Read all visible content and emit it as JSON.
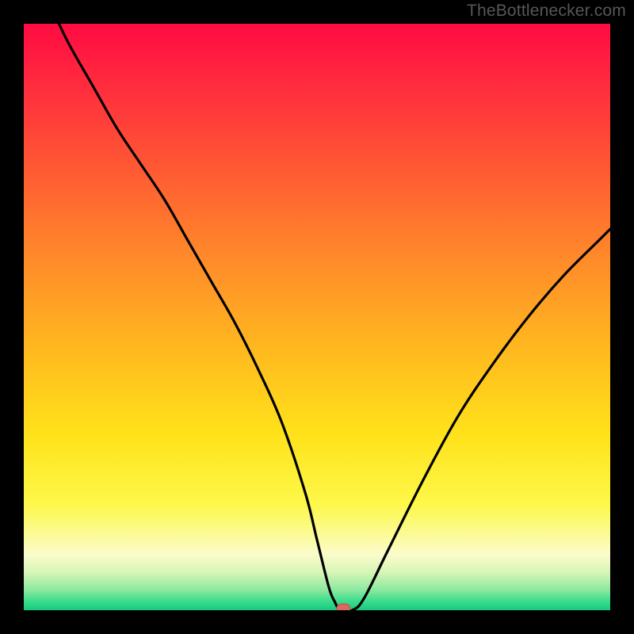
{
  "attribution": "TheBottlenecker.com",
  "colors": {
    "frame": "#000000",
    "gradient_stops": [
      {
        "offset": 0.0,
        "color": "#ff0b42"
      },
      {
        "offset": 0.1,
        "color": "#ff2a3e"
      },
      {
        "offset": 0.25,
        "color": "#ff5a33"
      },
      {
        "offset": 0.4,
        "color": "#ff8a2a"
      },
      {
        "offset": 0.55,
        "color": "#ffb71f"
      },
      {
        "offset": 0.7,
        "color": "#ffe21a"
      },
      {
        "offset": 0.82,
        "color": "#fdf84a"
      },
      {
        "offset": 0.905,
        "color": "#fbfccb"
      },
      {
        "offset": 0.935,
        "color": "#d8f5b7"
      },
      {
        "offset": 0.965,
        "color": "#8de9a0"
      },
      {
        "offset": 0.985,
        "color": "#3adc8c"
      },
      {
        "offset": 1.0,
        "color": "#18c97e"
      }
    ],
    "curve": "#000000",
    "marker_fill": "#d66a60",
    "marker_stroke": "#bb4f47"
  },
  "chart_data": {
    "type": "line",
    "title": "",
    "xlabel": "",
    "ylabel": "",
    "xlim": [
      0,
      100
    ],
    "ylim": [
      0,
      100
    ],
    "series": [
      {
        "name": "bottleneck-curve",
        "x": [
          6,
          8,
          12,
          16,
          20,
          24,
          28,
          32,
          36,
          40,
          44,
          48,
          50,
          52,
          53,
          54,
          56,
          58,
          62,
          68,
          74,
          80,
          86,
          92,
          98,
          100
        ],
        "values": [
          100,
          96,
          89,
          82,
          76,
          70,
          63,
          56,
          49,
          41,
          32,
          20,
          12,
          4,
          1.5,
          0,
          0,
          2,
          10,
          22,
          33,
          42,
          50,
          57,
          63,
          65
        ]
      }
    ],
    "marker": {
      "x": 54.5,
      "y": 0,
      "label": ""
    }
  }
}
